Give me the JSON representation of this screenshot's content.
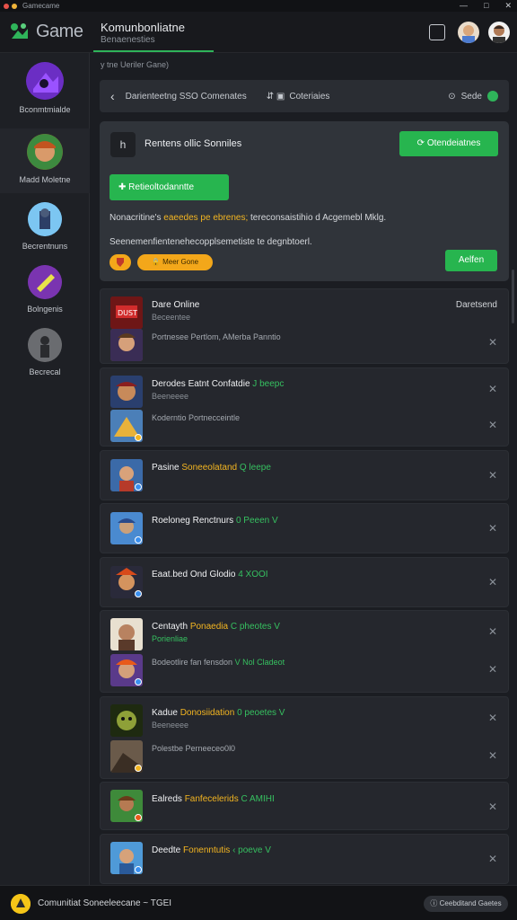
{
  "titlebar": {
    "title": "Gamecame"
  },
  "header": {
    "logo_text": "Game",
    "title": "Komunbonliatne",
    "subtitle": "Benaenesties"
  },
  "sidebar": {
    "items": [
      {
        "label": "Bconmtmialde"
      },
      {
        "label": "Madd Moletne"
      },
      {
        "label": "Becrentnuns"
      },
      {
        "label": "Bolngenis"
      },
      {
        "label": "Becrecal"
      }
    ]
  },
  "breadcrumb": {
    "text": "y tne Ueriler Gane)"
  },
  "toolbar": {
    "back_label": "‹",
    "left_text": "Darienteetng  SSO  Comenates",
    "mid_text": "Coteriaies",
    "right_text": "Sede"
  },
  "promo": {
    "icon_label": "h",
    "title": "Rentens ollic Sonniles",
    "top_button": "Otendeiatnes",
    "action_button": "Retieoltodanntte",
    "line1_a": "Nonacritine's ",
    "line1_b": "eaeedes pe ebrenes;",
    "line1_c": " tereconsaistihio d Acgemebl Mklg.",
    "line2": "Seenemenfientenehecopplsemetiste te degnbtoerl.",
    "pill_label": "Meer Gone",
    "apply_button": "Aelfen"
  },
  "games": [
    {
      "title": "Dare Online",
      "title_y": "",
      "title_g": "",
      "sub": "Beceentee",
      "sub_green": false,
      "status": "Daretsend",
      "row2": "Portnesee Pertlom, AMerba Panntio",
      "row2_g": ""
    },
    {
      "title": "Derodes Eatnt Confatdie ",
      "title_y": "",
      "title_g": "J beepc",
      "sub": "Beeneeee",
      "sub_green": false,
      "status": "",
      "row2": "Koderntio Portnecceintle",
      "row2_g": ""
    },
    {
      "title": "Pasine ",
      "title_y": "Soneeolatand",
      "title_g": " Q leepe",
      "sub": "",
      "sub_green": false,
      "status": "",
      "row2": "",
      "row2_g": ""
    },
    {
      "title": "Roeloneg Renctnurs ",
      "title_y": "",
      "title_g": "0 Peeen V",
      "sub": "",
      "sub_green": false,
      "status": "",
      "row2": "",
      "row2_g": ""
    },
    {
      "title": "Eaat.bed Ond Glodio ",
      "title_y": "",
      "title_g": "4 XOOI",
      "sub": "",
      "sub_green": false,
      "status": "",
      "row2": "",
      "row2_g": ""
    },
    {
      "title": "Centayth ",
      "title_y": "Ponaedia",
      "title_g": " C  pheotes V",
      "sub": "Porienliae",
      "sub_green": true,
      "status": "",
      "row2": "Bodeotlire fan fensdon ",
      "row2_g": "V  Nol Cladeot"
    },
    {
      "title": "Kadue ",
      "title_y": "Donosiidation",
      "title_g": "  0  peoetes V",
      "sub": "Beeneeee",
      "sub_green": false,
      "status": "",
      "row2": "Polestbe Perneeceo0l0",
      "row2_g": ""
    },
    {
      "title": "Ealreds ",
      "title_y": "Fanfecelerids",
      "title_g": "  C AMIHI",
      "sub": "",
      "sub_green": false,
      "status": "",
      "row2": "",
      "row2_g": ""
    },
    {
      "title": "Deedte  ",
      "title_y": "Fonenntutis",
      "title_g": "  ‹ poeve V",
      "sub": "",
      "sub_green": false,
      "status": "",
      "row2": "",
      "row2_g": ""
    }
  ],
  "footer": {
    "text": "Comunitiat Soneeleecane ~ TGEI",
    "pill": "Ceebditand Gaetes"
  },
  "colors": {
    "accent": "#27b54f",
    "highlight": "#f3b521",
    "background": "#1b1d22"
  }
}
